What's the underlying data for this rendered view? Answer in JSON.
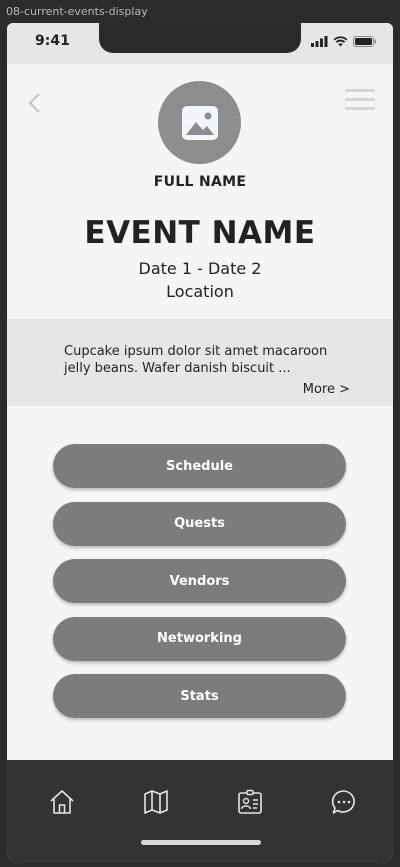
{
  "frame": {
    "label": "08-current-events-display"
  },
  "status_bar": {
    "time": "9:41"
  },
  "profile": {
    "full_name": "FULL NAME"
  },
  "event": {
    "name": "EVENT NAME",
    "dates": "Date 1 - Date 2",
    "location": "Location"
  },
  "description": {
    "text": "Cupcake ipsum dolor sit amet macaroon jelly beans. Wafer danish biscuit ...",
    "more_label": "More >"
  },
  "actions": [
    {
      "label": "Schedule"
    },
    {
      "label": "Quests"
    },
    {
      "label": "Vendors"
    },
    {
      "label": "Networking"
    },
    {
      "label": "Stats"
    }
  ],
  "tabs": [
    {
      "icon": "home-icon"
    },
    {
      "icon": "map-icon"
    },
    {
      "icon": "id-badge-icon"
    },
    {
      "icon": "chat-icon"
    }
  ],
  "colors": {
    "button": "#7c7c7c",
    "tab_bar": "#333333",
    "avatar": "#8d8d8d",
    "band": "#e6e6e6"
  }
}
